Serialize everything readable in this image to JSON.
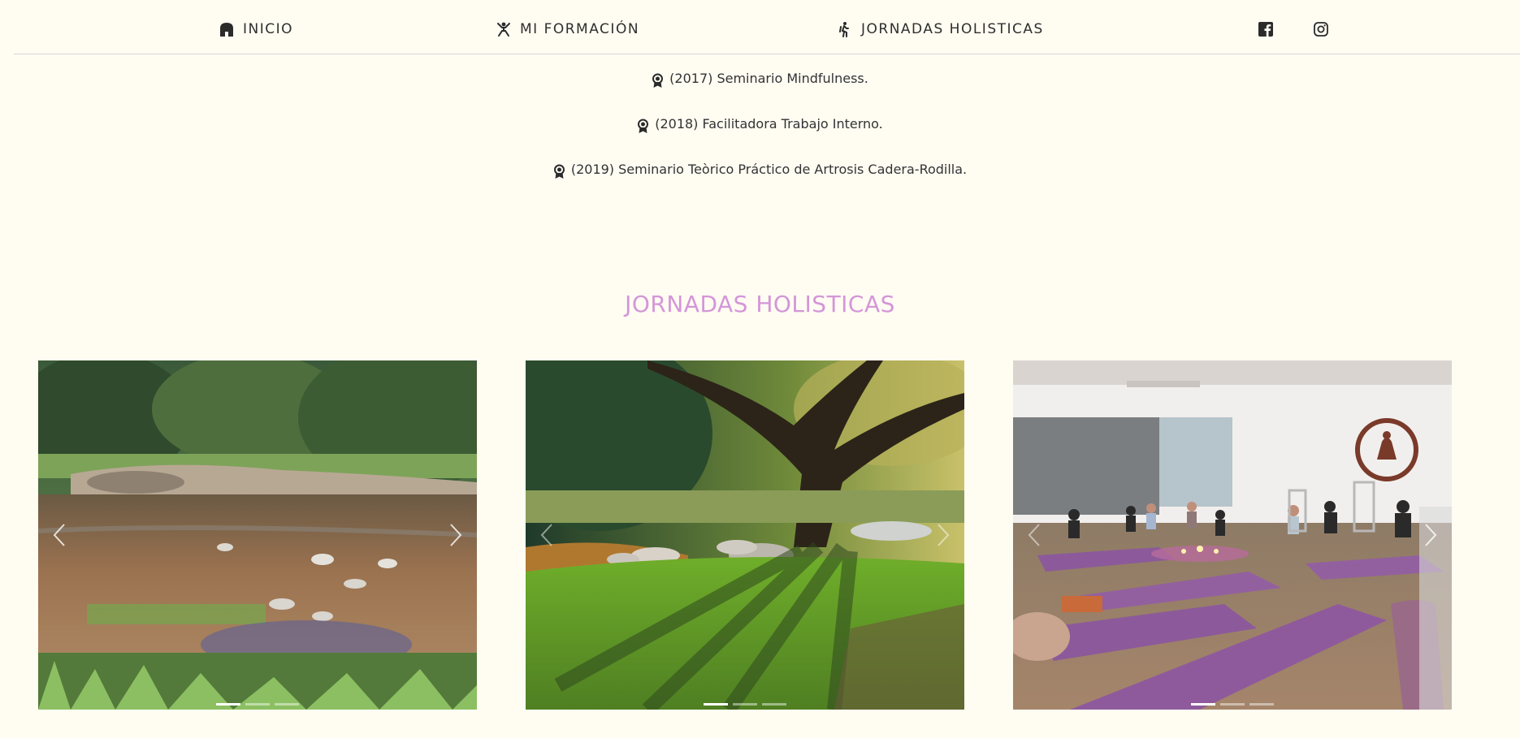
{
  "nav": {
    "items": [
      {
        "label": "INICIO",
        "icon": "home-icon"
      },
      {
        "label": "MI FORMACIÓN",
        "icon": "meditation-icon"
      },
      {
        "label": "JORNADAS HOLISTICAS",
        "icon": "hiking-icon"
      }
    ],
    "social": [
      {
        "icon": "facebook-icon"
      },
      {
        "icon": "instagram-icon"
      }
    ]
  },
  "certifications": [
    {
      "text": "(2017) Seminario Mindfulness.",
      "icon": "award-icon"
    },
    {
      "text": "(2018) Facilitadora Trabajo Interno.",
      "icon": "award-icon"
    },
    {
      "text": "(2019) Seminario Teòrico Práctico de Artrosis Cadera-Rodilla.",
      "icon": "award-icon"
    }
  ],
  "section": {
    "title": "JORNADAS HOLISTICAS"
  },
  "carousels": [
    {
      "image": "river-photo",
      "slides": 3,
      "active_slide": 1
    },
    {
      "image": "tree-photo",
      "slides": 3,
      "active_slide": 1
    },
    {
      "image": "yoga-class-photo",
      "slides": 3,
      "active_slide": 1
    }
  ],
  "colors": {
    "background": "#fffcf2",
    "accent": "#d496d8",
    "text": "#2f2f2f"
  }
}
